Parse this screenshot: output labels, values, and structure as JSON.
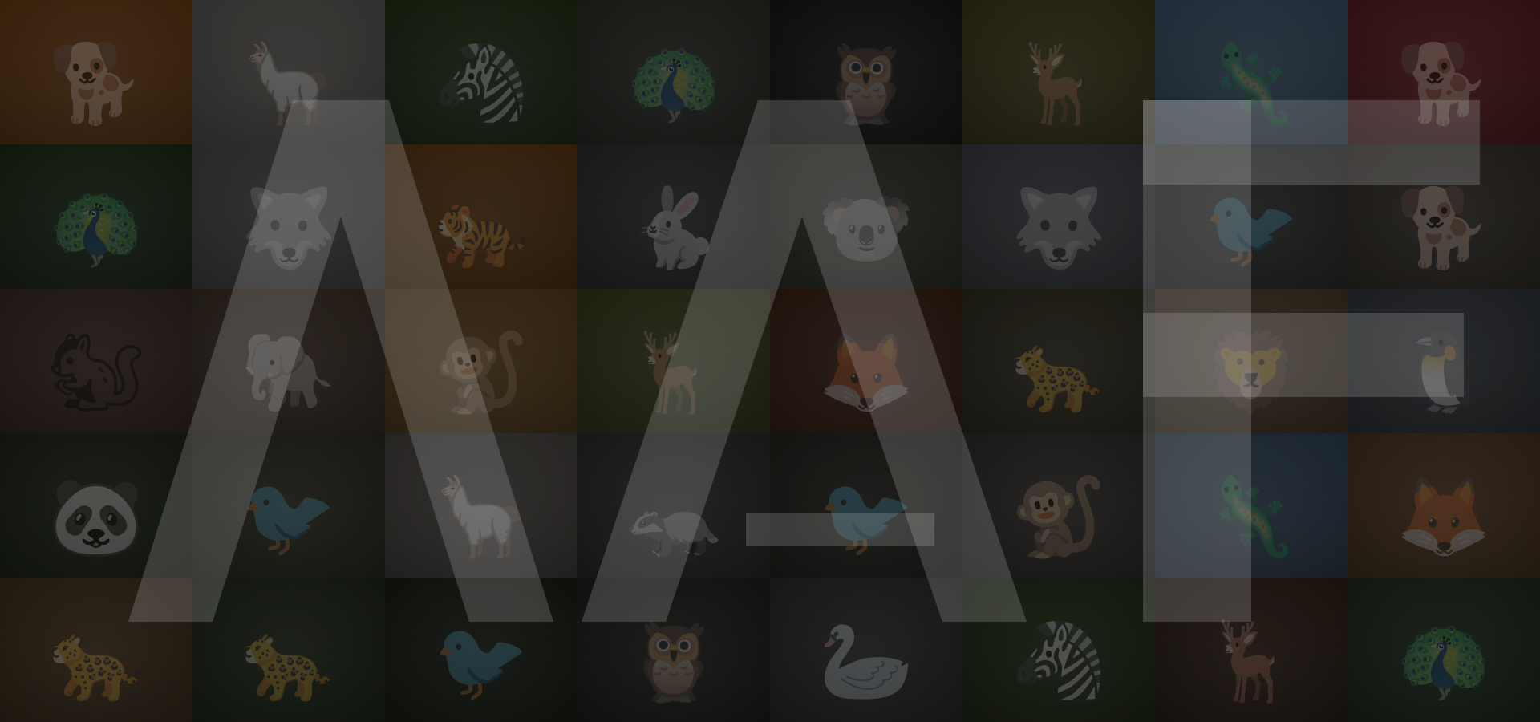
{
  "background": {
    "overlay_color": "#141414",
    "watermark_color": "#c8c8c8",
    "tiles": [
      {
        "animal": "shiba-inu",
        "glyph": "🐕",
        "color": "#7a4a22"
      },
      {
        "animal": "alpaca",
        "glyph": "🦙",
        "color": "#6d6a66"
      },
      {
        "animal": "zebra",
        "glyph": "🦓",
        "color": "#2f3f24"
      },
      {
        "animal": "peacock",
        "glyph": "🦚",
        "color": "#3a3d36"
      },
      {
        "animal": "owl",
        "glyph": "🦉",
        "color": "#262626"
      },
      {
        "animal": "kudu",
        "glyph": "🦌",
        "color": "#4d4a2a"
      },
      {
        "animal": "iguana",
        "glyph": "🦎",
        "color": "#4a6178"
      },
      {
        "animal": "dog-with-flag",
        "glyph": "🐕",
        "color": "#6b2b2e"
      },
      {
        "animal": "peacock",
        "glyph": "🦚",
        "color": "#2c3a26"
      },
      {
        "animal": "husky",
        "glyph": "🐺",
        "color": "#5a5a5a"
      },
      {
        "animal": "tiger",
        "glyph": "🐅",
        "color": "#6b4520"
      },
      {
        "animal": "hare",
        "glyph": "🐇",
        "color": "#3d3d3d"
      },
      {
        "animal": "koala",
        "glyph": "🐨",
        "color": "#3e4239"
      },
      {
        "animal": "wolf",
        "glyph": "🐺",
        "color": "#4a4d52"
      },
      {
        "animal": "bird",
        "glyph": "🐦",
        "color": "#3d403f"
      },
      {
        "animal": "dog",
        "glyph": "🐕",
        "color": "#45403b"
      },
      {
        "animal": "squirrel",
        "glyph": "🐿",
        "color": "#4a3a33"
      },
      {
        "animal": "elephant",
        "glyph": "🐘",
        "color": "#4d4037"
      },
      {
        "animal": "golden-monkey",
        "glyph": "🐒",
        "color": "#6b4f2a"
      },
      {
        "animal": "kudu",
        "glyph": "🦌",
        "color": "#454c2a"
      },
      {
        "animal": "fox-cub",
        "glyph": "🦊",
        "color": "#4a2f22"
      },
      {
        "animal": "cheetah",
        "glyph": "🐆",
        "color": "#3e3b2e"
      },
      {
        "animal": "lion",
        "glyph": "🦁",
        "color": "#5a4a38"
      },
      {
        "animal": "penguins",
        "glyph": "🐧",
        "color": "#41454a"
      },
      {
        "animal": "panda",
        "glyph": "🐼",
        "color": "#2c3325"
      },
      {
        "animal": "bird",
        "glyph": "🐦",
        "color": "#3b3c30"
      },
      {
        "animal": "alpaca",
        "glyph": "🦙",
        "color": "#585450"
      },
      {
        "animal": "armadillo",
        "glyph": "🦡",
        "color": "#3c3a38"
      },
      {
        "animal": "gouldian-finch",
        "glyph": "🐦",
        "color": "#30322c"
      },
      {
        "animal": "monkey",
        "glyph": "🐒",
        "color": "#3f3d3a"
      },
      {
        "animal": "iguana",
        "glyph": "🦎",
        "color": "#3f5264"
      },
      {
        "animal": "fennec-fox",
        "glyph": "🦊",
        "color": "#5a4430"
      },
      {
        "animal": "leopard",
        "glyph": "🐆",
        "color": "#4f3f2b"
      },
      {
        "animal": "cheetah",
        "glyph": "🐆",
        "color": "#2e3628"
      },
      {
        "animal": "oriole",
        "glyph": "🐦",
        "color": "#262b22"
      },
      {
        "animal": "owl",
        "glyph": "🦉",
        "color": "#2d2d2b"
      },
      {
        "animal": "stork",
        "glyph": "🦢",
        "color": "#3a3a3a"
      },
      {
        "animal": "zebra",
        "glyph": "🦓",
        "color": "#2f3a22"
      },
      {
        "animal": "deer-fawn",
        "glyph": "🦌",
        "color": "#3c2e25"
      },
      {
        "animal": "peacock",
        "glyph": "🦚",
        "color": "#2c3a2a"
      }
    ]
  }
}
